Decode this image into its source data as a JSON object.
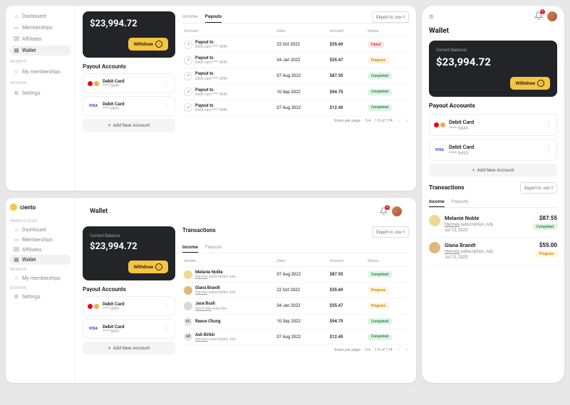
{
  "brand": "ciento",
  "nav": {
    "sections": [
      {
        "label": "AMBASSADOR",
        "items": [
          {
            "label": "Dashboard",
            "icon": "home"
          },
          {
            "label": "Memberships",
            "icon": "folder"
          },
          {
            "label": "Affiliates",
            "icon": "people"
          },
          {
            "label": "Wallet",
            "icon": "wallet",
            "active": true
          }
        ]
      },
      {
        "label": "MEMBER",
        "items": [
          {
            "label": "My memberships",
            "icon": "star"
          }
        ]
      },
      {
        "label": "GENERAL",
        "items": [
          {
            "label": "Settings",
            "icon": "gear"
          }
        ]
      }
    ]
  },
  "page": {
    "title": "Wallet",
    "notif_count": "3",
    "mobile_notif_count": "1"
  },
  "balance": {
    "label": "Current Balance",
    "amount": "$23,994.72",
    "withdraw": "Withdraw"
  },
  "accounts": {
    "title": "Payout Accounts",
    "add": "Add New Account",
    "list": [
      {
        "brand": "mc",
        "name": "Debit Card",
        "last4": "**** 5849"
      },
      {
        "brand": "visa",
        "name": "Debit Card",
        "last4": "**** 8493"
      }
    ]
  },
  "transactions": {
    "title": "Transactions",
    "export": "Export in .csv",
    "tabs": {
      "income": "Income",
      "payouts": "Payouts"
    },
    "headers": {
      "sender": "Sender",
      "account": "Account",
      "date": "Date",
      "amount": "Amount",
      "status": "Status"
    },
    "pager": {
      "rpp_label": "Rows per page:",
      "rpp": "5",
      "range": "1-5 of 174"
    },
    "payouts": [
      {
        "to": "Payout to",
        "sub": "Debit card **** 5849",
        "date": "22 Oct 2022",
        "amount": "$55.69",
        "status": "Failed",
        "s": "failed"
      },
      {
        "to": "Payout to",
        "sub": "Debit card **** 5849",
        "date": "04 Jan 2022",
        "amount": "$55.47",
        "status": "Progress",
        "s": "progress"
      },
      {
        "to": "Payout to",
        "sub": "Debit card **** 5849",
        "date": "07 Aug 2022",
        "amount": "$87.55",
        "status": "Completed",
        "s": "completed"
      },
      {
        "to": "Payout to",
        "sub": "Debit card **** 5849",
        "date": "10 Sep 2022",
        "amount": "$94.75",
        "status": "Completed",
        "s": "completed"
      },
      {
        "to": "Payout to",
        "sub": "Debit card **** 5849",
        "date": "07 Aug 2022",
        "amount": "$12.45",
        "status": "Completed",
        "s": "completed"
      }
    ],
    "income": [
      {
        "name": "Melanie Noble",
        "sub_a": "Hermes",
        "sub_b": " subscription July",
        "date": "07 Aug 2022",
        "amount": "$87.55",
        "status": "Completed",
        "s": "completed",
        "av": "#f0d890"
      },
      {
        "name": "Giana Brandt",
        "sub_a": "Hermes",
        "sub_b": " subscription July",
        "date": "22 Oct 2022",
        "amount": "$55.69",
        "status": "Progress",
        "s": "progress",
        "av": "#e0b878"
      },
      {
        "name": "Jace Bush",
        "sub_a": "Sport Stile",
        "sub_b": " entry fee",
        "date": "04 Jan 2022",
        "amount": "$55.47",
        "status": "Progress",
        "s": "progress",
        "av": "#d8d8d8"
      },
      {
        "name": "Reece Chung",
        "sub_a": "",
        "sub_b": "",
        "initials": "RC",
        "date": "10 Sep 2022",
        "amount": "$94.75",
        "status": "Completed",
        "s": "completed",
        "av": "#e8e8e8"
      },
      {
        "name": "Ash Birkin",
        "sub_a": "Hermes",
        "sub_b": " subscription July",
        "initials": "AB",
        "date": "07 Aug 2022",
        "amount": "$12.45",
        "status": "Completed",
        "s": "completed",
        "av": "#e8e8e8"
      }
    ]
  },
  "mobile_tx": [
    {
      "name": "Melanie Noble",
      "sub_a": "Hermes",
      "sub_b": " subscription July",
      "date": "Jul 12, 2023",
      "amount": "$87.55",
      "status": "Completed",
      "s": "completed",
      "av": "#f0d890"
    },
    {
      "name": "Giana Brandt",
      "sub_a": "Hermes",
      "sub_b": " subscription July",
      "date": "Jul 12, 2023",
      "amount": "$55.00",
      "status": "Progress",
      "s": "progress",
      "av": "#e0b878"
    }
  ]
}
